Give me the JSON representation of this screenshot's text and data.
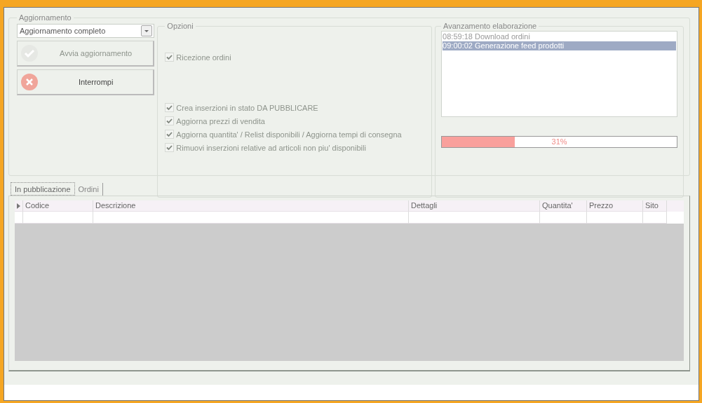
{
  "update_group": {
    "title": "Aggiornamento",
    "mode_select": {
      "value": "Aggiornamento completo"
    },
    "buttons": [
      {
        "kind": "start",
        "label": "Avvia aggiornamento",
        "disabled": true
      },
      {
        "kind": "stop",
        "label": "Interrompi",
        "disabled": false
      }
    ],
    "options": {
      "title": "Opzioni",
      "groups": [
        {
          "items": [
            {
              "label": "Ricezione ordini",
              "checked": true,
              "disabled": true
            }
          ]
        },
        {
          "items": [
            {
              "label": "Crea inserzioni in stato DA PUBBLICARE",
              "checked": true,
              "disabled": true
            },
            {
              "label": "Aggiorna prezzi di vendita",
              "checked": true,
              "disabled": true
            },
            {
              "label": "Aggiorna quantita' / Relist disponibili / Aggiorna tempi di consegna",
              "checked": true,
              "disabled": true
            },
            {
              "label": "Rimuovi inserzioni relative ad articoli non piu' disponibili",
              "checked": true,
              "disabled": true
            }
          ]
        }
      ]
    },
    "progress": {
      "title": "Avanzamento elaborazione",
      "log": [
        {
          "time": "08:59:18",
          "text": "Download ordini",
          "selected": false
        },
        {
          "time": "09:00:02",
          "text": "Generazione feed prodotti",
          "selected": true
        }
      ],
      "level": 0.31,
      "reading": "31%"
    }
  },
  "tabs": [
    {
      "label": "In pubblicazione",
      "selected": true
    },
    {
      "label": "Ordini",
      "selected": false
    }
  ],
  "table": {
    "columns": [
      "Codice",
      "Descrizione",
      "Dettagli",
      "Quantita'",
      "Prezzo",
      "Sito"
    ]
  }
}
